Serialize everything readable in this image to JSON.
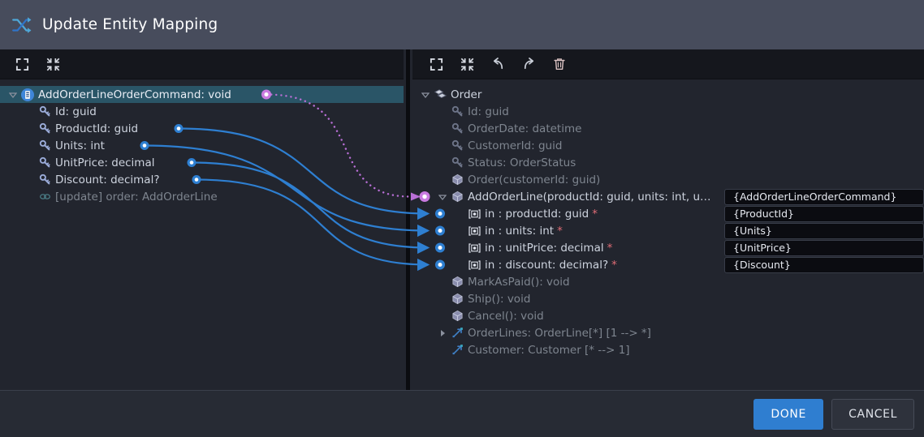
{
  "window": {
    "title": "Update Entity Mapping",
    "title_icon": "shuffle-mapping-icon",
    "accent_color": "#2f7ed0",
    "titlebar_color": "#474c5c",
    "panel_color": "#22252e",
    "selection_color": "#2a5567"
  },
  "left_toolbar": {
    "buttons": [
      {
        "name": "expand-all-button",
        "icon": "expand-icon",
        "label": "Expand all"
      },
      {
        "name": "collapse-all-button",
        "icon": "collapse-icon",
        "label": "Collapse all"
      }
    ]
  },
  "right_toolbar": {
    "buttons": [
      {
        "name": "expand-all-button",
        "icon": "expand-icon",
        "label": "Expand all"
      },
      {
        "name": "collapse-all-button",
        "icon": "collapse-icon",
        "label": "Collapse all"
      },
      {
        "name": "undo-button",
        "icon": "undo-icon",
        "label": "Undo"
      },
      {
        "name": "redo-button",
        "icon": "redo-icon",
        "label": "Redo"
      },
      {
        "name": "delete-button",
        "icon": "trash-icon",
        "label": "Delete"
      }
    ]
  },
  "source_tree": {
    "rows": [
      {
        "label": "AddOrderLineOrderCommand: void",
        "icon": "command-document-icon",
        "indent": 0,
        "twisty": "expanded",
        "selected": true,
        "style": "bright"
      },
      {
        "label": "Id: guid",
        "icon": "key-icon",
        "indent": 1,
        "twisty": "none",
        "selected": false,
        "style": "normal"
      },
      {
        "label": "ProductId: guid",
        "icon": "key-icon",
        "indent": 1,
        "twisty": "none",
        "selected": false,
        "style": "normal"
      },
      {
        "label": "Units: int",
        "icon": "key-icon",
        "indent": 1,
        "twisty": "none",
        "selected": false,
        "style": "normal"
      },
      {
        "label": "UnitPrice: decimal",
        "icon": "key-icon",
        "indent": 1,
        "twisty": "none",
        "selected": false,
        "style": "normal"
      },
      {
        "label": "Discount: decimal?",
        "icon": "key-icon",
        "indent": 1,
        "twisty": "none",
        "selected": false,
        "style": "normal"
      },
      {
        "label": "[update] order: AddOrderLine",
        "icon": "link-chain-icon",
        "indent": 1,
        "twisty": "none",
        "selected": false,
        "style": "dim"
      }
    ]
  },
  "target_tree": {
    "rows": [
      {
        "label": "Order",
        "icon": "entity-icon",
        "indent": 0,
        "twisty": "expanded",
        "style": "normal",
        "required": false
      },
      {
        "label": "Id: guid",
        "icon": "key-icon-dim",
        "indent": 1,
        "twisty": "none",
        "style": "dim",
        "required": false
      },
      {
        "label": "OrderDate: datetime",
        "icon": "key-icon-dim",
        "indent": 1,
        "twisty": "none",
        "style": "dim",
        "required": false
      },
      {
        "label": "CustomerId: guid",
        "icon": "key-icon-dim",
        "indent": 1,
        "twisty": "none",
        "style": "dim",
        "required": false
      },
      {
        "label": "Status: OrderStatus",
        "icon": "key-icon-dim",
        "indent": 1,
        "twisty": "none",
        "style": "dim",
        "required": false
      },
      {
        "label": "Order(customerId: guid)",
        "icon": "method-cube-icon",
        "indent": 1,
        "twisty": "none",
        "style": "dim",
        "required": false
      },
      {
        "label": "AddOrderLine(productId: guid, units: int, u…",
        "icon": "method-cube-icon",
        "indent": 1,
        "twisty": "expanded",
        "style": "normal",
        "required": false
      },
      {
        "label": "in : productId: guid",
        "icon": "parameter-icon",
        "indent": 2,
        "twisty": "none",
        "style": "normal",
        "required": true
      },
      {
        "label": "in : units: int",
        "icon": "parameter-icon",
        "indent": 2,
        "twisty": "none",
        "style": "normal",
        "required": true
      },
      {
        "label": "in : unitPrice: decimal",
        "icon": "parameter-icon",
        "indent": 2,
        "twisty": "none",
        "style": "normal",
        "required": true
      },
      {
        "label": "in : discount: decimal?",
        "icon": "parameter-icon",
        "indent": 2,
        "twisty": "none",
        "style": "normal",
        "required": true
      },
      {
        "label": "MarkAsPaid(): void",
        "icon": "method-cube-icon",
        "indent": 1,
        "twisty": "none",
        "style": "dim",
        "required": false
      },
      {
        "label": "Ship(): void",
        "icon": "method-cube-icon",
        "indent": 1,
        "twisty": "none",
        "style": "dim",
        "required": false
      },
      {
        "label": "Cancel(): void",
        "icon": "method-cube-icon",
        "indent": 1,
        "twisty": "none",
        "style": "dim",
        "required": false
      },
      {
        "label": "OrderLines: OrderLine[*] [1 --> *]",
        "icon": "relation-arrow-icon",
        "indent": 1,
        "twisty": "collapsed",
        "style": "dim",
        "required": false
      },
      {
        "label": "Customer: Customer [* --> 1]",
        "icon": "relation-arrow-icon",
        "indent": 1,
        "twisty": "none",
        "style": "dim",
        "required": false
      }
    ]
  },
  "mapping_values": [
    {
      "name": "value-box-addorderline",
      "value": "{AddOrderLineOrderCommand}",
      "row_index": 6
    },
    {
      "name": "value-box-productid",
      "value": "{ProductId}",
      "row_index": 7
    },
    {
      "name": "value-box-units",
      "value": "{Units}",
      "row_index": 8
    },
    {
      "name": "value-box-unitprice",
      "value": "{UnitPrice}",
      "row_index": 9
    },
    {
      "name": "value-box-discount",
      "value": "{Discount}",
      "row_index": 10
    }
  ],
  "connections": [
    {
      "from": "AddOrderLineOrderCommand",
      "to": "AddOrderLine",
      "style": "dotted",
      "color": "#b96fd6"
    },
    {
      "from": "ProductId",
      "to": "productId",
      "style": "solid",
      "color": "#2e7fd1"
    },
    {
      "from": "Units",
      "to": "units",
      "style": "solid",
      "color": "#2e7fd1"
    },
    {
      "from": "UnitPrice",
      "to": "unitPrice",
      "style": "solid",
      "color": "#2e7fd1"
    },
    {
      "from": "Discount",
      "to": "discount",
      "style": "solid",
      "color": "#2e7fd1"
    }
  ],
  "footer": {
    "done_label": "DONE",
    "cancel_label": "CANCEL"
  }
}
